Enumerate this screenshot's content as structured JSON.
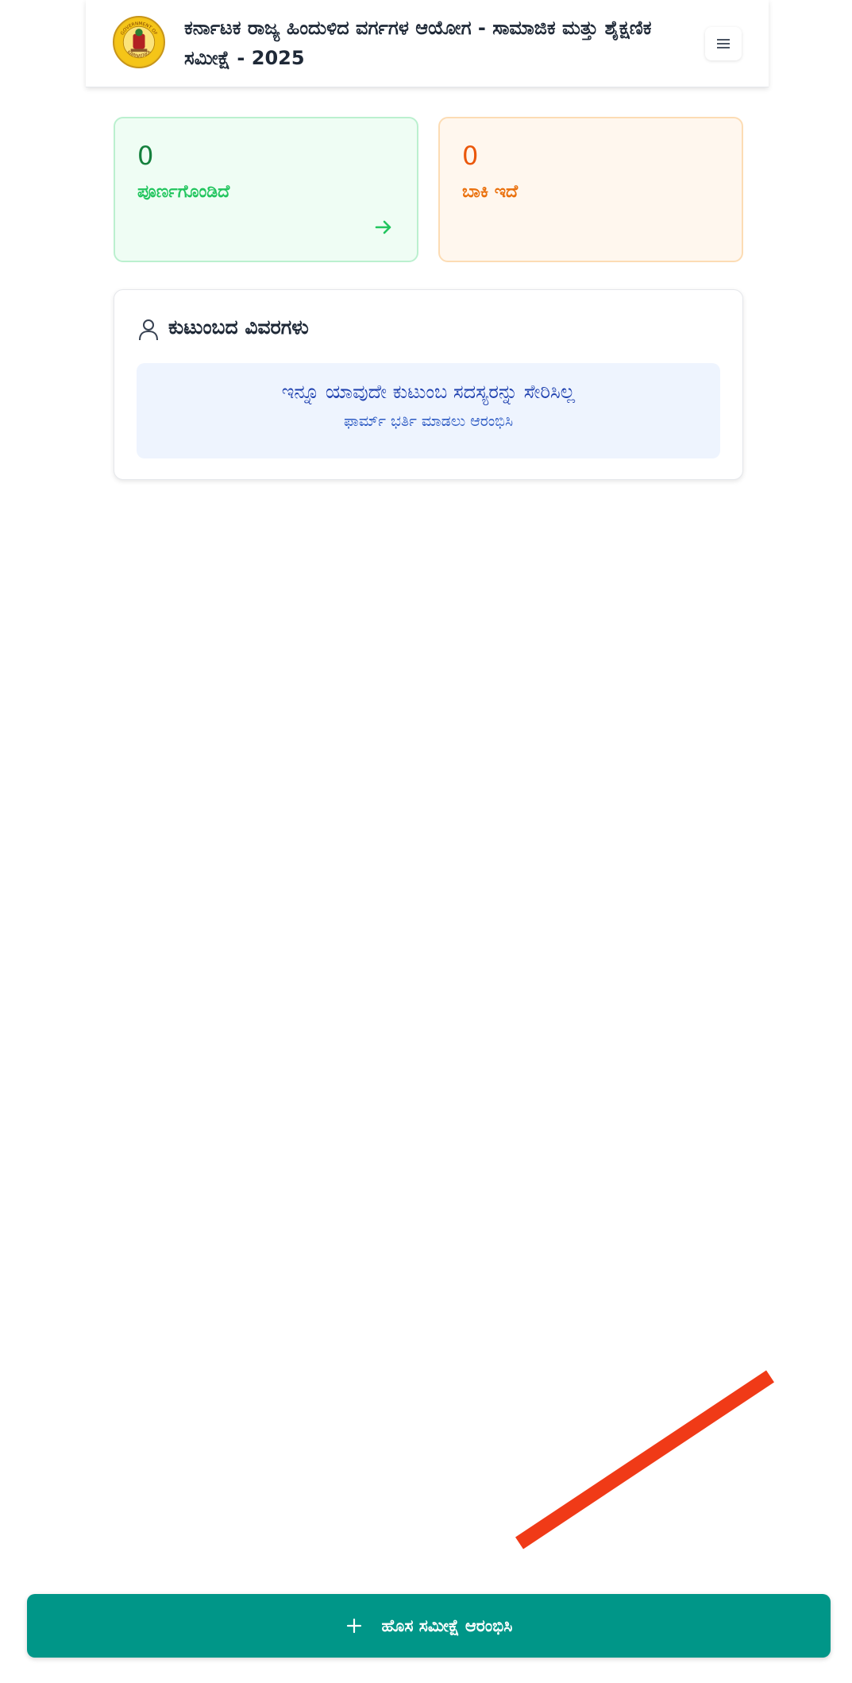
{
  "header": {
    "title": "ಕರ್ನಾಟಕ ರಾಜ್ಯ ಹಿಂದುಳಿದ ವರ್ಗಗಳ ಆಯೋಗ - ಸಾಮಾಜಿಕ ಮತ್ತು ಶೈಕ್ಷಣಿಕ ಸಮೀಕ್ಷೆ - 2025",
    "emblem_text_top": "GOVERNMENT OF",
    "emblem_text_bottom": "KARNATAKA",
    "menu_icon": "hamburger-icon"
  },
  "stats": {
    "completed": {
      "value": "0",
      "label": "ಪೂರ್ಣಗೊಂಡಿದೆ",
      "icon": "arrow-right-icon"
    },
    "pending": {
      "value": "0",
      "label": "ಬಾಕಿ ಇದೆ"
    }
  },
  "family": {
    "title": "ಕುಟುಂಬದ ವಿವರಗಳು",
    "icon": "user-icon",
    "empty_message": "ಇನ್ನೂ ಯಾವುದೇ ಕುಟುಂಬ ಸದಸ್ಯರನ್ನು ಸೇರಿಸಿಲ್ಲ",
    "empty_hint": "ಫಾರ್ಮ್ ಭರ್ತಿ ಮಾಡಲು ಆರಂಭಿಸಿ"
  },
  "action": {
    "start_label": "ಹೊಸ ಸಮೀಕ್ಷೆ ಆರಂಭಿಸಿ",
    "icon": "plus-icon"
  },
  "colors": {
    "primary": "#009688",
    "completed_text": "#15803d",
    "pending_text": "#ea580c",
    "info_text": "#1e40af",
    "annotation_red": "#f03a17"
  }
}
